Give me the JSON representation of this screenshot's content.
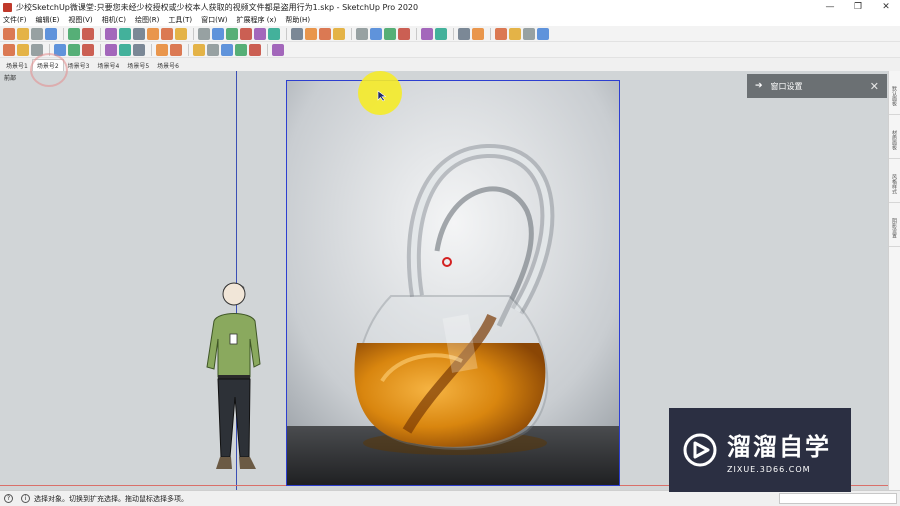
{
  "window": {
    "title": "少校SketchUp微课堂:只要您未经少校授权或少校本人获取的视频文件都是盗用行为1.skp - SketchUp Pro 2020",
    "minimize_glyph": "—",
    "maximize_glyph": "❐",
    "close_glyph": "✕"
  },
  "menubar": {
    "items": [
      {
        "label": "文件(F)"
      },
      {
        "label": "编辑(E)"
      },
      {
        "label": "视图(V)"
      },
      {
        "label": "相机(C)"
      },
      {
        "label": "绘图(R)"
      },
      {
        "label": "工具(T)"
      },
      {
        "label": "窗口(W)"
      },
      {
        "label": "扩展程序 (x)"
      },
      {
        "label": "帮助(H)"
      }
    ]
  },
  "scene_tabs": {
    "tabs": [
      {
        "label": "场景号1",
        "active": false
      },
      {
        "label": "场景号2",
        "active": true
      },
      {
        "label": "场景号3",
        "active": false
      },
      {
        "label": "场景号4",
        "active": false
      },
      {
        "label": "场景号5",
        "active": false
      },
      {
        "label": "场景号6",
        "active": false
      }
    ]
  },
  "viewport": {
    "label": "前部"
  },
  "panel": {
    "arrow_glyph": "➔",
    "title": "窗口设置",
    "close_glyph": "✕"
  },
  "side_tray": {
    "tabs": [
      {
        "label": "默认面板"
      },
      {
        "label": "材质面板"
      },
      {
        "label": "风格样式"
      },
      {
        "label": "阴影设置"
      }
    ]
  },
  "statusbar": {
    "info_icon": "?",
    "hint_icon": "i",
    "text": "选择对象。切换到扩充选择。拖动鼠标选择多项。"
  },
  "watermark": {
    "name": "溜溜自学",
    "url": "ZIXUE.3D66.COM"
  },
  "colors": {
    "selection_blue": "#2d3fd0",
    "axis_red": "#d9706a",
    "panel_gray": "#6b7073",
    "liquid_amber": "#d9860f",
    "cursor_yellow": "#f5eb28"
  },
  "icons": {
    "toolbar_1": [
      "orbit-icon",
      "play-icon",
      "record-icon",
      "prev-icon",
      "walk-icon",
      "person-icon",
      "print-icon",
      "settings-icon",
      "gear-icon",
      "box-icon",
      "cylinder-icon",
      "render-icon",
      "file-icon",
      "copy-icon",
      "paste-icon",
      "delete-icon",
      "sync-icon",
      "paint-icon",
      "pin-icon",
      "sphere-icon",
      "ruler-icon",
      "eraser-icon",
      "arrow-icon",
      "bucket-icon",
      "s-logo-icon",
      "route-icon",
      "frame-icon",
      "zoom-icon",
      "gem-icon",
      "cube-icon",
      "grid-icon",
      "axis-icon",
      "measure-icon",
      "node-icon"
    ],
    "toolbar_2": [
      "home-icon",
      "refresh-icon",
      "sun-icon",
      "swap-icon",
      "link-icon",
      "tree-icon",
      "layers-icon",
      "grid-icon",
      "fill-icon",
      "camera-icon",
      "chart-icon",
      "wall-icon",
      "door-icon",
      "window-icon",
      "roof-icon",
      "stair-icon",
      "globe-icon"
    ]
  }
}
